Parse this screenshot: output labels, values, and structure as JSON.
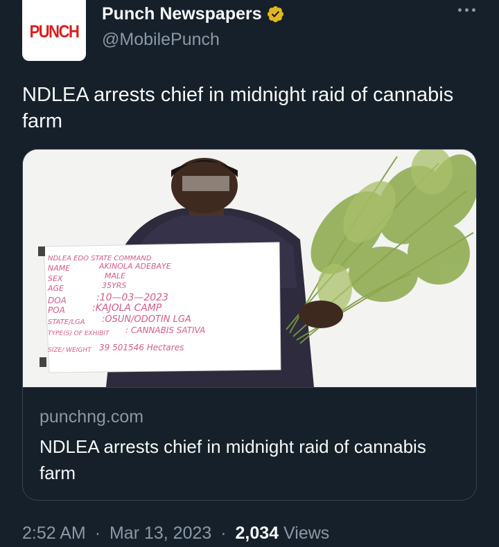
{
  "author": {
    "logo_text": "PUNCH",
    "display_name": "Punch Newspapers",
    "handle": "@MobilePunch"
  },
  "tweet": {
    "text": "NDLEA arrests chief in midnight raid of cannabis farm"
  },
  "card": {
    "domain": "punchng.com",
    "title": "NDLEA arrests chief in midnight raid of cannabis farm",
    "sign": {
      "header": "NDLEA EDO STATE COMMAND",
      "name_label": "NAME",
      "name_value": "AKINOLA ADEBAYE",
      "sex_label": "SEX",
      "sex_value": "MALE",
      "age_label": "AGE",
      "age_value": "35YRS",
      "doa_label": "DOA",
      "doa_value": ":10—03—2023",
      "poa_label": "POA",
      "poa_value": ":KAJOLA CAMP",
      "state_label": "STATE/LGA",
      "state_value": ":OSUN/ODOTIN LGA",
      "type_label": "TYPE(S) OF EXHIBIT",
      "type_value": ": CANNABIS SATIVA",
      "size_label": "SIZE/ WEIGHT",
      "size_value": "39 501546 Hectares"
    }
  },
  "meta": {
    "time": "2:52 AM",
    "separator": "·",
    "date": "Mar 13, 2023",
    "views_count": "2,034",
    "views_label": "Views"
  },
  "colors": {
    "background": "#15202b",
    "primary_text": "#f7f9f9",
    "secondary_text": "#8b98a5",
    "border": "#38444d",
    "verified_badge": "#e2b719",
    "logo_red": "#d81e1e"
  },
  "icons": {
    "verified": "verified-badge-icon",
    "more": "more-options-icon"
  }
}
